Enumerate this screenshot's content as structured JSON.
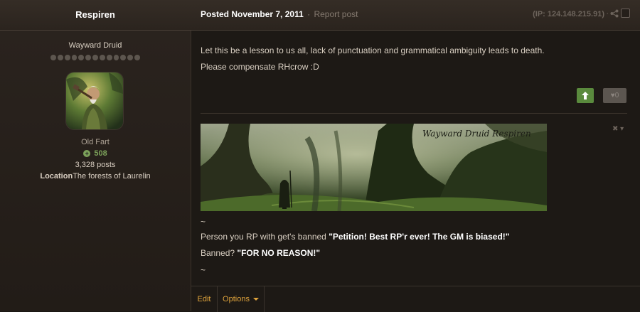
{
  "header": {
    "author": "Respiren",
    "posted_prefix": "Posted",
    "posted_date": "November 7, 2011",
    "separator": "·",
    "report": "Report post",
    "ip": "(IP: 124.148.215.91)"
  },
  "sidebar": {
    "group": "Wayward Druid",
    "rank": "Old Fart",
    "reputation": "508",
    "posts": "3,328 posts",
    "location_label": "Location",
    "location_value": "The forests of Laurelin"
  },
  "post": {
    "line1": "Let this be a lesson to us all, lack of punctuation and grammatical ambiguity leads to death.",
    "line2": "Please compensate RHcrow :D",
    "likes": "0"
  },
  "signature": {
    "banner_text": "Wayward Druid Respiren",
    "tilde1": "~",
    "line1_pre": "Person you RP with get's banned ",
    "line1_bold": "\"Petition! Best RP'r ever! The GM is biased!\"",
    "line2_pre": "Banned? ",
    "line2_bold": "\"FOR NO REASON!\"",
    "tilde2": "~",
    "controls": "✖ ▾"
  },
  "footer": {
    "edit": "Edit",
    "options": "Options"
  }
}
